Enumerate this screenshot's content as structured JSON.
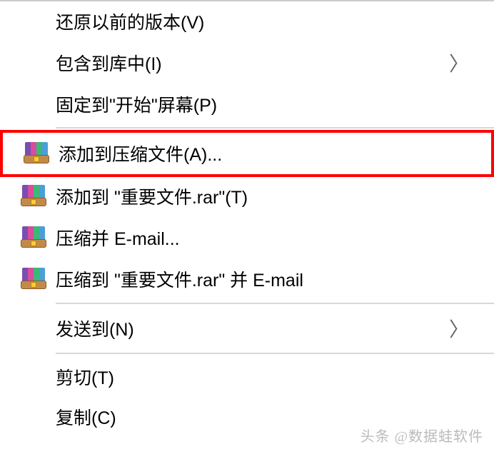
{
  "menu": {
    "items": [
      {
        "label": "还原以前的版本(V)",
        "hasIcon": false,
        "hasSubmenu": false
      },
      {
        "label": "包含到库中(I)",
        "hasIcon": false,
        "hasSubmenu": true
      },
      {
        "label": "固定到\"开始\"屏幕(P)",
        "hasIcon": false,
        "hasSubmenu": false
      },
      {
        "label": "添加到压缩文件(A)...",
        "hasIcon": true,
        "hasSubmenu": false,
        "highlighted": true
      },
      {
        "label": "添加到 \"重要文件.rar\"(T)",
        "hasIcon": true,
        "hasSubmenu": false
      },
      {
        "label": "压缩并 E-mail...",
        "hasIcon": true,
        "hasSubmenu": false
      },
      {
        "label": "压缩到 \"重要文件.rar\" 并 E-mail",
        "hasIcon": true,
        "hasSubmenu": false
      },
      {
        "label": "发送到(N)",
        "hasIcon": false,
        "hasSubmenu": true
      },
      {
        "label": "剪切(T)",
        "hasIcon": false,
        "hasSubmenu": false
      },
      {
        "label": "复制(C)",
        "hasIcon": false,
        "hasSubmenu": false
      }
    ]
  },
  "watermark": "头条 @数据蛙软件"
}
